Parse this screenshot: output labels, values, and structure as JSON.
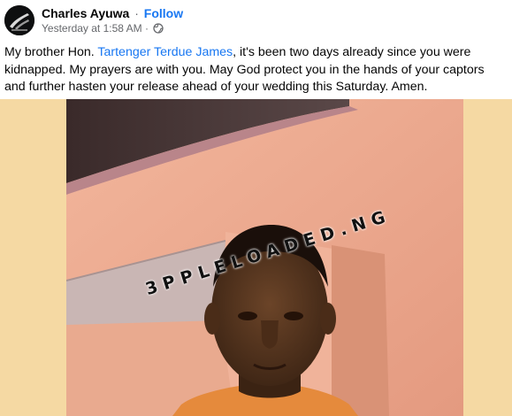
{
  "post": {
    "author": "Charles Ayuwa",
    "separator": "·",
    "follow_label": "Follow",
    "timestamp": "Yesterday at 1:58 AM",
    "meta_separator": "·",
    "audience_icon": "globe-icon",
    "text_before": "My brother Hon. ",
    "mention": "Tartenger Terdue James",
    "text_after": ", it's been two days already since you were kidnapped. My prayers are with you. May God protect you in the hands of your captors and further hasten your release ahead of your wedding this Saturday. Amen."
  },
  "photo": {
    "watermark": "3PPLELOADED.NG",
    "background_color": "#f5d9a3"
  },
  "colors": {
    "link": "#1877f2",
    "text": "#050505",
    "secondary": "#65676b"
  }
}
